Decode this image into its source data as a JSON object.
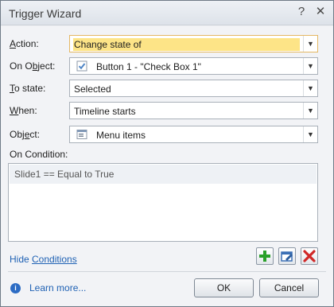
{
  "window": {
    "title": "Trigger Wizard",
    "help_glyph": "?",
    "close_glyph": "✕"
  },
  "fields": {
    "action": {
      "label": "Action:",
      "value": "Change state of"
    },
    "on_object": {
      "label": "On Object:",
      "value": "Button 1 - \"Check Box 1\"",
      "icon": "checkbox-icon"
    },
    "to_state": {
      "label": "To state:",
      "value": "Selected"
    },
    "when": {
      "label": "When:",
      "value": "Timeline starts"
    },
    "object": {
      "label": "Object:",
      "value": "Menu items",
      "icon": "menu-items-icon"
    }
  },
  "conditions": {
    "label": "On Condition:",
    "items": [
      "Slide1 == Equal to True"
    ],
    "hide_link": "Hide Conditions"
  },
  "toolbar": {
    "add_icon": "plus-icon",
    "edit_icon": "edit-icon",
    "delete_icon": "delete-icon"
  },
  "footer": {
    "learn_more": "Learn more...",
    "ok": "OK",
    "cancel": "Cancel"
  },
  "colors": {
    "link": "#2062b4",
    "highlight": "#fde487",
    "add_green": "#2aa02a",
    "delete_red": "#d02828"
  }
}
